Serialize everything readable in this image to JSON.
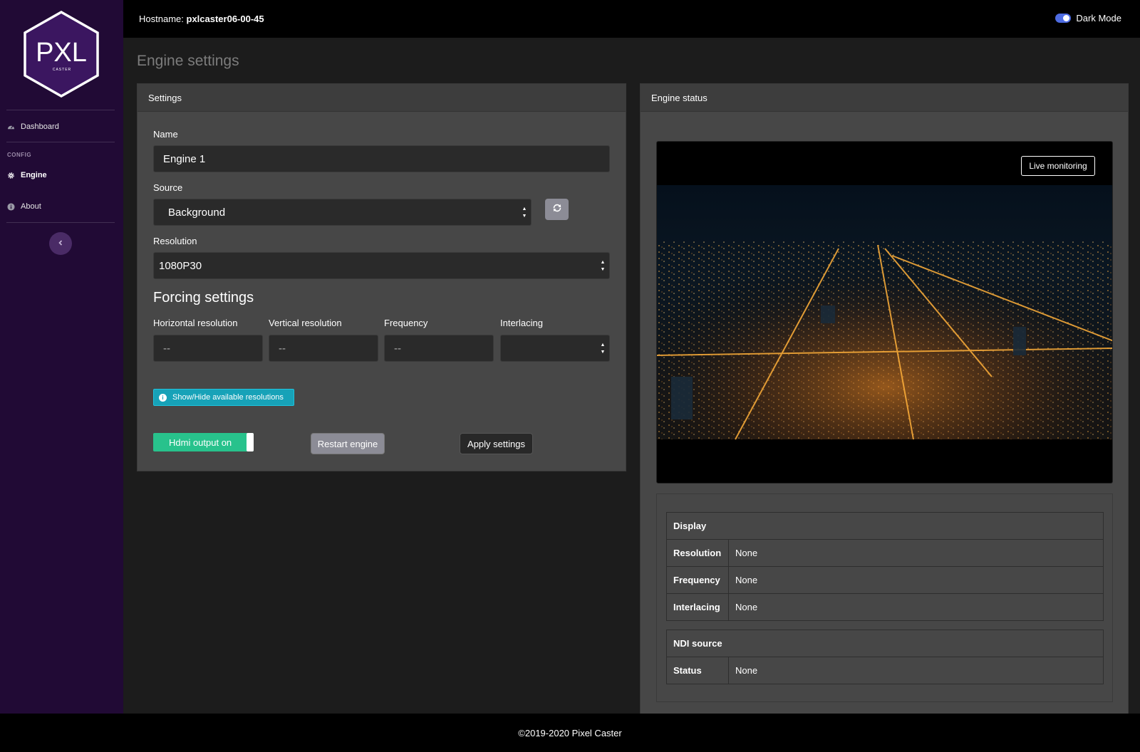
{
  "app": {
    "brand": "PXL",
    "brand_sub": "CASTER"
  },
  "sidebar": {
    "items": [
      {
        "label": "Dashboard",
        "icon": "dashboard-icon"
      },
      {
        "label": "Engine",
        "icon": "gear-icon",
        "active": true
      },
      {
        "label": "About",
        "icon": "info-icon"
      }
    ],
    "section_heading": "CONFIG",
    "collapse_icon": "chevron-left-icon"
  },
  "topbar": {
    "hostname_label": "Hostname:",
    "hostname_value": "pxlcaster06-00-45",
    "dark_mode_label": "Dark Mode",
    "dark_mode_on": true
  },
  "page": {
    "title": "Engine settings"
  },
  "settings": {
    "header": "Settings",
    "name_label": "Name",
    "name_value": "Engine 1",
    "source_label": "Source",
    "source_value": "Background",
    "resolution_label": "Resolution",
    "resolution_value": "1080P30",
    "forcing_title": "Forcing settings",
    "horizontal_label": "Horizontal resolution",
    "horizontal_placeholder": "--",
    "vertical_label": "Vertical resolution",
    "vertical_placeholder": "--",
    "frequency_label": "Frequency",
    "frequency_placeholder": "--",
    "interlacing_label": "Interlacing",
    "interlacing_value": "",
    "show_hide_label": "Show/Hide available resolutions",
    "hdmi_label": "Hdmi output on",
    "restart_label": "Restart engine",
    "apply_label": "Apply settings"
  },
  "status": {
    "header": "Engine status",
    "live_monitoring_label": "Live monitoring",
    "display_heading": "Display",
    "rows": [
      {
        "key": "Resolution",
        "value": "None"
      },
      {
        "key": "Frequency",
        "value": "None"
      },
      {
        "key": "Interlacing",
        "value": "None"
      }
    ],
    "ndi_heading": "NDI source",
    "ndi_rows": [
      {
        "key": "Status",
        "value": "None"
      }
    ]
  },
  "footer": {
    "text": "©2019-2020 Pixel Caster"
  },
  "colors": {
    "sidebar_bg": "#210a35",
    "accent_toggle": "#4e6ce2",
    "hdmi_green": "#28c28c",
    "info_cyan": "#17a2b8"
  }
}
